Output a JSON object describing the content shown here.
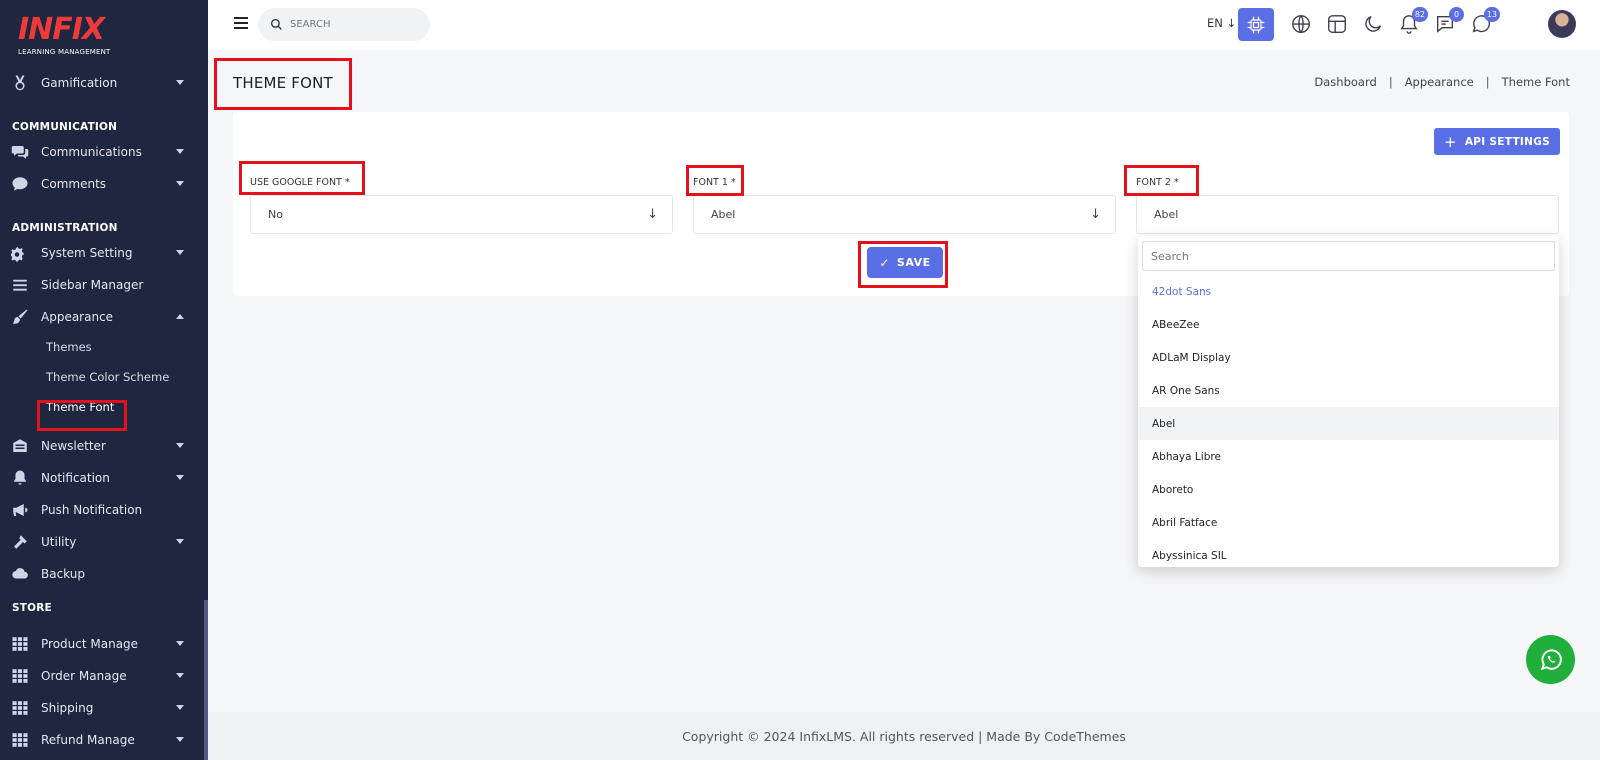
{
  "brand": {
    "logo_text": "INFIX",
    "logo_sub": "LEARNING MANAGEMENT"
  },
  "sidebar": {
    "gamification": "Gamification",
    "section_communication": "COMMUNICATION",
    "communications": "Communications",
    "comments": "Comments",
    "section_administration": "ADMINISTRATION",
    "system_setting": "System Setting",
    "sidebar_manager": "Sidebar Manager",
    "appearance": "Appearance",
    "themes": "Themes",
    "theme_color_scheme": "Theme Color Scheme",
    "theme_font": "Theme Font",
    "newsletter": "Newsletter",
    "notification": "Notification",
    "push_notification": "Push Notification",
    "utility": "Utility",
    "backup": "Backup",
    "section_store": "STORE",
    "product_manage": "Product Manage",
    "order_manage": "Order Manage",
    "shipping": "Shipping",
    "refund_manage": "Refund Manage"
  },
  "header": {
    "search_placeholder": "SEARCH",
    "lang": "EN",
    "badge_notifications": "82",
    "badge_messages": "0",
    "badge_whatsapp": "13"
  },
  "page": {
    "title": "THEME FONT",
    "breadcrumb": [
      "Dashboard",
      "Appearance",
      "Theme Font"
    ],
    "api_settings": "API SETTINGS",
    "label_google": "USE GOOGLE FONT *",
    "label_font1": "FONT 1 *",
    "label_font2": "FONT 2 *",
    "value_google": "No",
    "value_font1": "Abel",
    "value_font2": "Abel",
    "save": "SAVE"
  },
  "dropdown": {
    "search_placeholder": "Search",
    "options": [
      "42dot Sans",
      "ABeeZee",
      "ADLaM Display",
      "AR One Sans",
      "Abel",
      "Abhaya Libre",
      "Aboreto",
      "Abril Fatface",
      "Abyssinica SIL"
    ]
  },
  "footer": {
    "text": "Copyright © 2024 InfixLMS. All rights reserved | Made By CodeThemes"
  },
  "colors": {
    "sidebar_bg": "#1f2740",
    "accent": "#5a6ee6",
    "highlight": "#e2111c",
    "brand_red": "#ef3a3a",
    "whatsapp": "#1faf3a"
  }
}
